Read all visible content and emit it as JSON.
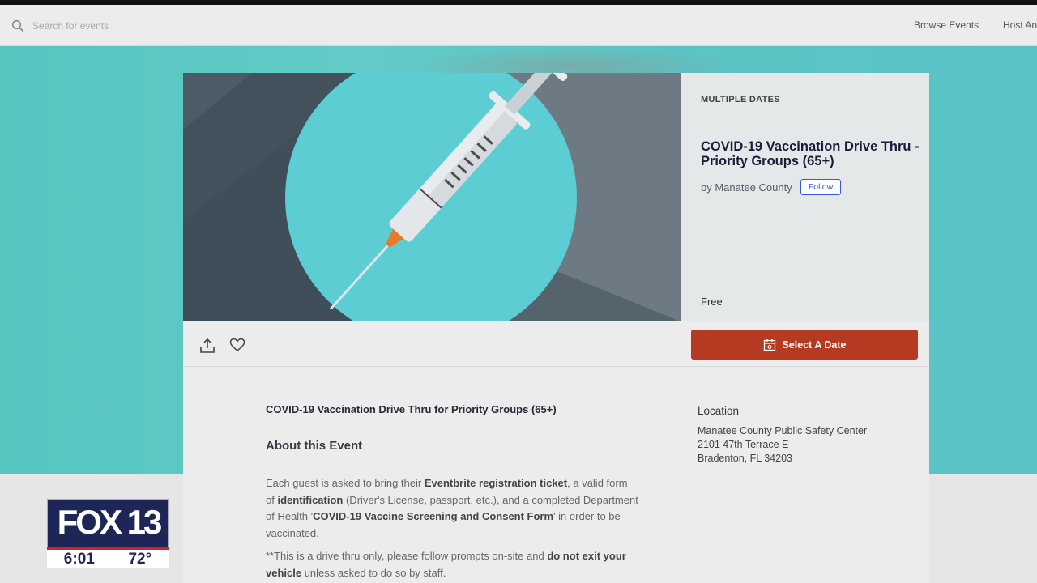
{
  "header": {
    "search_placeholder": "Search for events",
    "nav": [
      "Browse Events",
      "Host An"
    ]
  },
  "event": {
    "date_label": "MULTIPLE DATES",
    "title": "COVID-19 Vaccination Drive Thru - Priority Groups (65+)",
    "organizer": "by Manatee County",
    "follow_label": "Follow",
    "price": "Free",
    "select_button": "Select A Date"
  },
  "content": {
    "subtitle": "COVID-19 Vaccination Drive Thru for Priority Groups (65+)",
    "about_heading": "About this Event",
    "para1": [
      {
        "t": "Each guest is asked to bring their ",
        "b": false
      },
      {
        "t": "Eventbrite registration ticket",
        "b": true
      },
      {
        "t": ", a valid form of ",
        "b": false
      },
      {
        "t": "identification",
        "b": true
      },
      {
        "t": " (Driver's License, passport, etc.), and a completed Department of Health '",
        "b": false
      },
      {
        "t": "COVID-19 Vaccine Screening and Consent Form",
        "b": true
      },
      {
        "t": "' in order to be vaccinated.",
        "b": false
      }
    ],
    "para2": [
      {
        "t": "**This is a drive thru only, please follow prompts on-site and ",
        "b": false
      },
      {
        "t": "do not exit your vehicle",
        "b": true
      },
      {
        "t": " unless asked to do so by staff.",
        "b": false
      }
    ]
  },
  "location": {
    "heading": "Location",
    "lines": [
      "Manatee County Public Safety Center",
      "2101 47th Terrace E",
      "Bradenton, FL 34203"
    ]
  },
  "overlay": {
    "logo_text": "FOX 13",
    "time": "6:01",
    "temperature": "72°"
  },
  "colors": {
    "teal_background": "#5ec8c4",
    "select_button": "#b43b22",
    "follow_accent": "#3659e3",
    "hero_circle": "#5ccdd3",
    "fox_navy": "#1d2657"
  }
}
